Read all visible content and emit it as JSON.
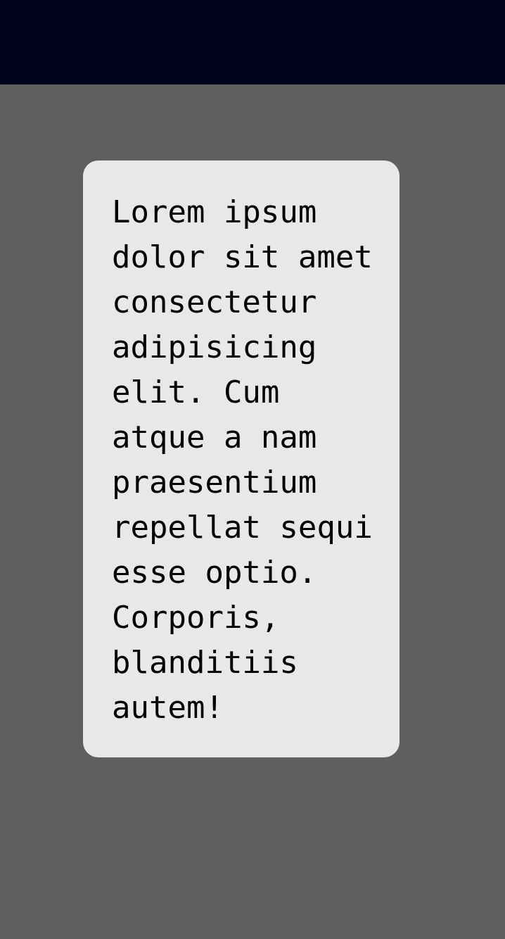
{
  "card": {
    "text": "Lorem ipsum dolor sit amet consectetur adipisicing elit. Cum atque a nam praesentium repellat sequi esse optio. Corporis, blanditiis autem!"
  },
  "colors": {
    "top_bar": "#02021c",
    "background": "#5f5f5f",
    "card": "#e8e8ea",
    "text": "#000000"
  }
}
